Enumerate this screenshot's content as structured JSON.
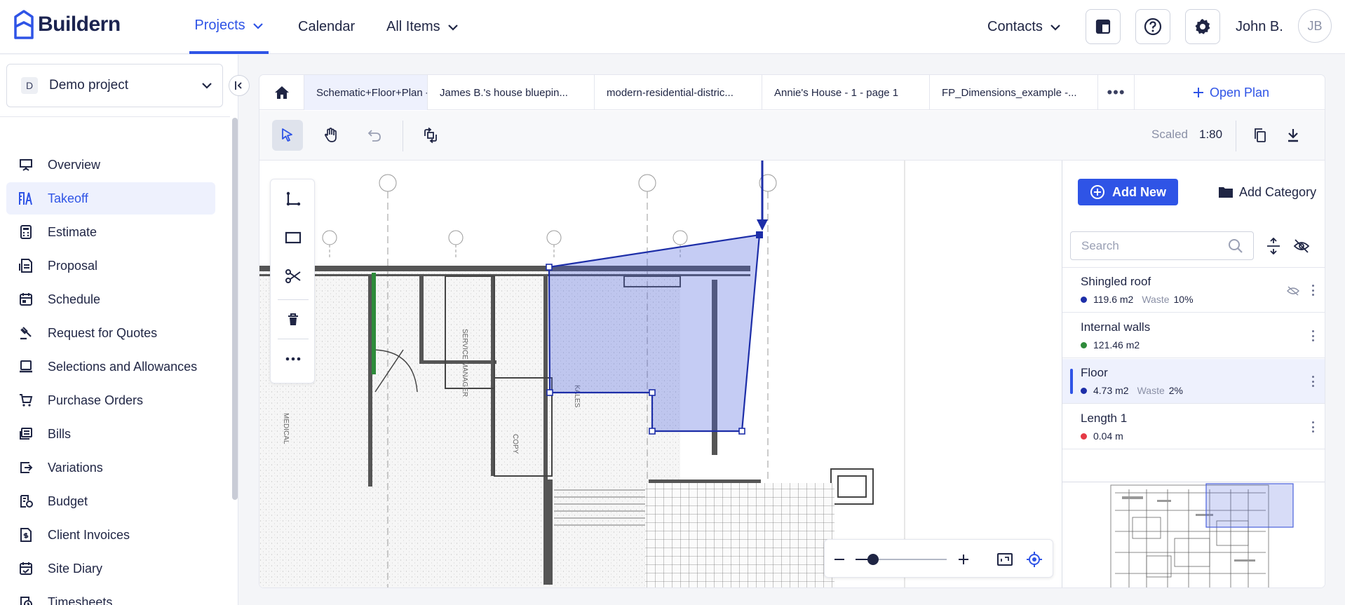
{
  "app": {
    "brand": "Buildern"
  },
  "topnav": {
    "items": [
      {
        "label": "Projects",
        "active": true,
        "dropdown": true
      },
      {
        "label": "Calendar",
        "active": false,
        "dropdown": false
      },
      {
        "label": "All Items",
        "active": false,
        "dropdown": true
      },
      {
        "label": "Contacts",
        "active": false,
        "dropdown": true
      }
    ],
    "icons": [
      "dashboard-icon",
      "help-icon",
      "settings-icon"
    ],
    "user_name": "John B.",
    "user_initials": "JB"
  },
  "sidebar": {
    "project_badge": "D",
    "project_name": "Demo project",
    "items": [
      {
        "label": "Overview",
        "icon": "presentation-icon"
      },
      {
        "label": "Takeoff",
        "icon": "takeoff-icon",
        "active": true
      },
      {
        "label": "Estimate",
        "icon": "calculator-icon"
      },
      {
        "label": "Proposal",
        "icon": "proposal-icon"
      },
      {
        "label": "Schedule",
        "icon": "calendar-icon"
      },
      {
        "label": "Request for Quotes",
        "icon": "gavel-icon"
      },
      {
        "label": "Selections and Allowances",
        "icon": "selections-icon"
      },
      {
        "label": "Purchase Orders",
        "icon": "cart-icon"
      },
      {
        "label": "Bills",
        "icon": "bills-icon"
      },
      {
        "label": "Variations",
        "icon": "variations-icon"
      },
      {
        "label": "Budget",
        "icon": "budget-icon"
      },
      {
        "label": "Client Invoices",
        "icon": "invoice-icon"
      },
      {
        "label": "Site Diary",
        "icon": "diary-icon"
      },
      {
        "label": "Timesheets",
        "icon": "timesheet-icon"
      }
    ]
  },
  "tabs": {
    "items": [
      {
        "label": "Schematic+Floor+Plan - p...",
        "active": true,
        "closable": true
      },
      {
        "label": "James B.'s house bluepin...",
        "active": false
      },
      {
        "label": "modern-residential-distric...",
        "active": false
      },
      {
        "label": "Annie's House - 1 - page 1",
        "active": false
      },
      {
        "label": "FP_Dimensions_example -...",
        "active": false
      }
    ],
    "more": "•••",
    "open_plan": "Open Plan"
  },
  "toolbar": {
    "scaled_label": "Scaled",
    "scale_value": "1:80"
  },
  "right_panel": {
    "add_new": "Add New",
    "add_category": "Add Category",
    "search_placeholder": "Search",
    "items": [
      {
        "name": "Shingled roof",
        "value": "119.6 m2",
        "waste_label": "Waste",
        "waste": "10%",
        "color": "#1d2ea8",
        "hidden": true
      },
      {
        "name": "Internal walls",
        "value": "121.46 m2",
        "waste_label": "",
        "waste": "",
        "color": "#2e8b3a"
      },
      {
        "name": "Floor",
        "value": "4.73 m2",
        "waste_label": "Waste",
        "waste": "2%",
        "color": "#1d2ea8",
        "active": true
      },
      {
        "name": "Length 1",
        "value": "0.04 m",
        "waste_label": "",
        "waste": "",
        "color": "#e53945"
      }
    ]
  },
  "colors": {
    "accent": "#2f54e6",
    "brand_dark": "#1c2450"
  }
}
